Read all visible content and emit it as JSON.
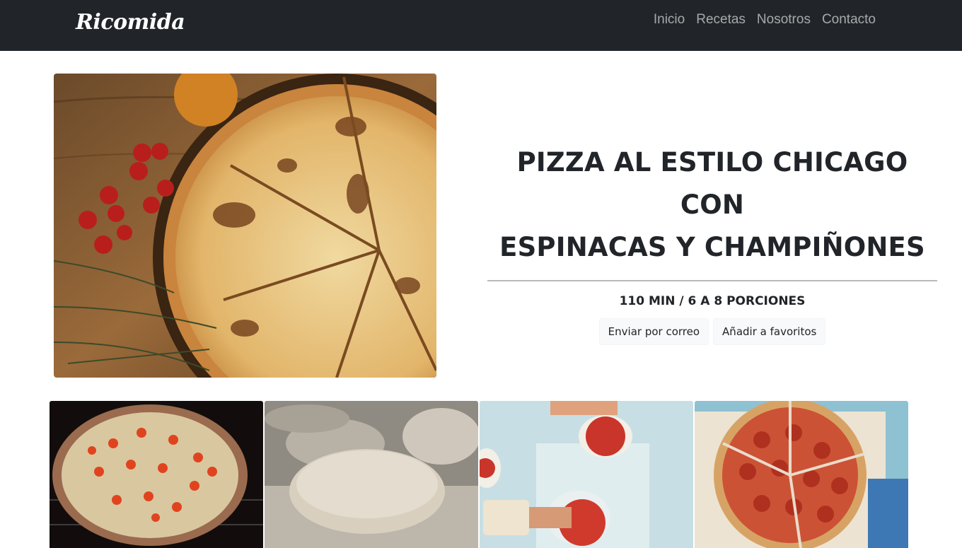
{
  "navbar": {
    "brand": "Ricomida",
    "links": [
      "Inicio",
      "Recetas",
      "Nosotros",
      "Contacto"
    ]
  },
  "recipe": {
    "title_line1": "PIZZA AL ESTILO CHICAGO CON",
    "title_line2": "ESPINACAS Y CHAMPIÑONES",
    "meta": "110 MIN / 6 A 8 PORCIONES",
    "buttons": {
      "email": "Enviar por correo",
      "favorites": "Añadir a favoritos"
    }
  },
  "colors": {
    "navbar_bg": "#212529",
    "nav_link": "rgba(255,255,255,0.6)",
    "button_bg": "#f8f9fa"
  }
}
